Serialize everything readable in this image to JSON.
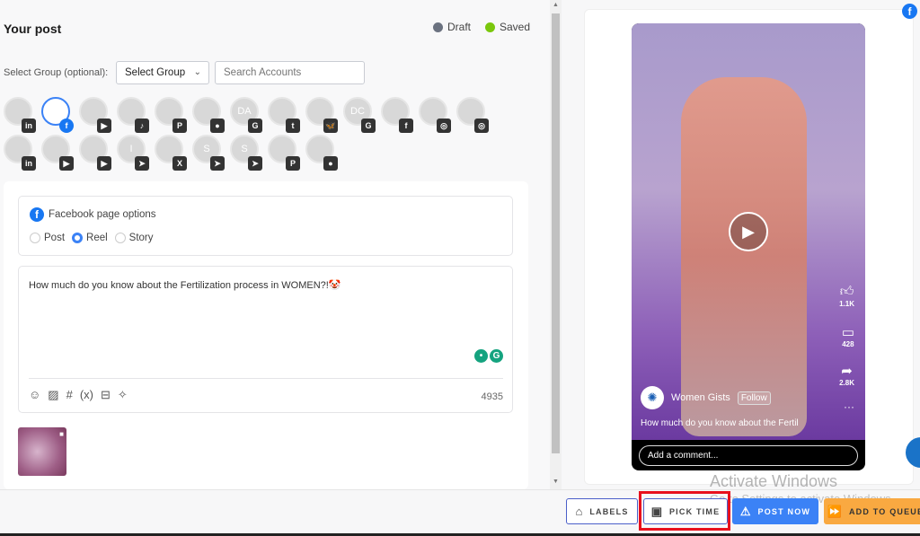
{
  "header": {
    "title": "Your post",
    "status": [
      {
        "label": "Draft",
        "color": "#6b7280"
      },
      {
        "label": "Saved",
        "color": "#7ac70c"
      }
    ]
  },
  "group": {
    "label": "Select Group (optional):",
    "select_value": "Select Group",
    "search_placeholder": "Search Accounts"
  },
  "accounts": [
    {
      "initials": "",
      "platform": "linkedin",
      "badge": "in"
    },
    {
      "initials": "",
      "platform": "facebook",
      "badge": "f",
      "selected": true
    },
    {
      "initials": "",
      "platform": "youtube",
      "badge": "▶"
    },
    {
      "initials": "",
      "platform": "tiktok",
      "badge": "♪"
    },
    {
      "initials": "",
      "platform": "pinterest",
      "badge": "P"
    },
    {
      "initials": "",
      "platform": "reddit",
      "badge": "●"
    },
    {
      "initials": "DA",
      "platform": "google-business",
      "badge": "G"
    },
    {
      "initials": "",
      "platform": "tumblr",
      "badge": "t"
    },
    {
      "initials": "",
      "platform": "bluesky",
      "badge": "🦋"
    },
    {
      "initials": "DC",
      "platform": "google-business",
      "badge": "G"
    },
    {
      "initials": "",
      "platform": "facebook",
      "badge": "f"
    },
    {
      "initials": "",
      "platform": "instagram",
      "badge": "◎"
    },
    {
      "initials": "",
      "platform": "instagram",
      "badge": "◎"
    },
    {
      "initials": "",
      "platform": "linkedin",
      "badge": "in"
    },
    {
      "initials": "",
      "platform": "youtube",
      "badge": "▶"
    },
    {
      "initials": "",
      "platform": "youtube",
      "badge": "▶"
    },
    {
      "initials": "I",
      "platform": "telegram",
      "badge": "➤"
    },
    {
      "initials": "",
      "platform": "x",
      "badge": "X"
    },
    {
      "initials": "S",
      "platform": "telegram",
      "badge": "➤"
    },
    {
      "initials": "S",
      "platform": "telegram",
      "badge": "➤"
    },
    {
      "initials": "",
      "platform": "pinterest",
      "badge": "P"
    },
    {
      "initials": "",
      "platform": "reddit",
      "badge": "●"
    }
  ],
  "facebook_options": {
    "title": "Facebook page options",
    "types": [
      {
        "label": "Post",
        "selected": false
      },
      {
        "label": "Reel",
        "selected": true
      },
      {
        "label": "Story",
        "selected": false
      }
    ]
  },
  "editor": {
    "text": "How much do you know about the Fertilization process in WOMEN?!🤡",
    "char_count": "4935",
    "tools": [
      "emoji-icon",
      "image-icon",
      "hashtag-icon",
      "variable-icon",
      "snippet-icon",
      "ai-sparkle-icon"
    ]
  },
  "preview": {
    "account": "Women Gists",
    "follow": "Follow",
    "caption": "How much do you know about the Fertil",
    "likes": "1.1K",
    "comments": "428",
    "shares": "2.8K",
    "comment_placeholder": "Add a comment..."
  },
  "watermark": {
    "line1": "Activate Windows",
    "line2": "Go to Settings to activate Windows."
  },
  "actions": {
    "labels": "LABELS",
    "pick_time": "PICK TIME",
    "post_now": "POST NOW",
    "add_to_queue": "ADD TO QUEUE"
  },
  "colors": {
    "accent": "#3b82f6",
    "facebook": "#1877f2",
    "post_now": "#3b82f6",
    "queue": "#f9a941",
    "highlight": "#e8101d"
  }
}
